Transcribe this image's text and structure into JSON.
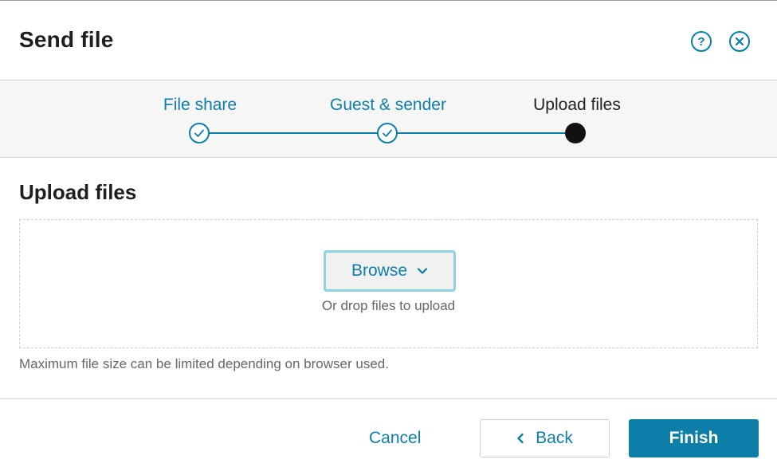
{
  "dialog": {
    "title": "Send file",
    "help_label": "?"
  },
  "stepper": {
    "steps": [
      {
        "label": "File share",
        "state": "done"
      },
      {
        "label": "Guest & sender",
        "state": "done"
      },
      {
        "label": "Upload files",
        "state": "current"
      }
    ],
    "accent_color": "#0d7ea8"
  },
  "upload": {
    "section_title": "Upload files",
    "browse_label": "Browse",
    "drop_hint": "Or drop files to upload",
    "size_note": "Maximum file size can be limited depending on browser used."
  },
  "footer": {
    "cancel_label": "Cancel",
    "back_label": "Back",
    "finish_label": "Finish"
  },
  "icons": {
    "help": "help-circle-icon",
    "close": "close-circle-icon",
    "step_done": "check-icon",
    "browse_dropdown": "chevron-down-icon",
    "back": "chevron-left-icon"
  }
}
